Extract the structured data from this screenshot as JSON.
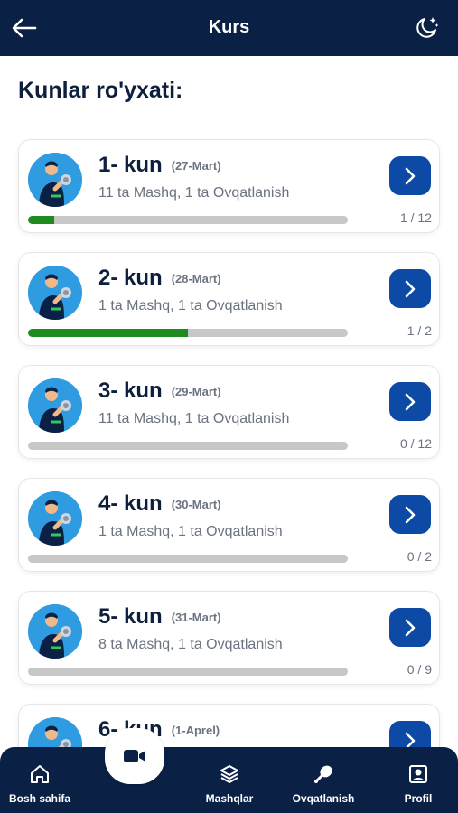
{
  "header": {
    "title": "Kurs",
    "back_icon": "arrow-left-icon",
    "theme_icon": "moon-stars-icon"
  },
  "heading": "Kunlar ro'yxati:",
  "days": [
    {
      "title": "1- kun",
      "date": "(27-Mart)",
      "subtitle": "11 ta Mashq, 1 ta Ovqatlanish",
      "count": "1 / 12",
      "progress": 0.083
    },
    {
      "title": "2- kun",
      "date": "(28-Mart)",
      "subtitle": "1 ta Mashq, 1 ta Ovqatlanish",
      "count": "1 / 2",
      "progress": 0.5
    },
    {
      "title": "3- kun",
      "date": "(29-Mart)",
      "subtitle": "11 ta Mashq, 1 ta Ovqatlanish",
      "count": "0 / 12",
      "progress": 0
    },
    {
      "title": "4- kun",
      "date": "(30-Mart)",
      "subtitle": "1 ta Mashq, 1 ta Ovqatlanish",
      "count": "0 / 2",
      "progress": 0
    },
    {
      "title": "5- kun",
      "date": "(31-Mart)",
      "subtitle": "8 ta Mashq, 1 ta Ovqatlanish",
      "count": "0 / 9",
      "progress": 0
    },
    {
      "title": "6- kun",
      "date": "(1-Aprel)",
      "subtitle": "",
      "count": "",
      "progress": 0
    }
  ],
  "colors": {
    "navy": "#0a2145",
    "button_blue": "#0c4aa6",
    "progress_green": "#1f8a1f",
    "track_gray": "#c7c7c7"
  },
  "nav": {
    "home": "Bosh sahifa",
    "video_icon": "video-camera-icon",
    "exercises": "Mashqlar",
    "nutrition": "Ovqatlanish",
    "profile": "Profil"
  }
}
